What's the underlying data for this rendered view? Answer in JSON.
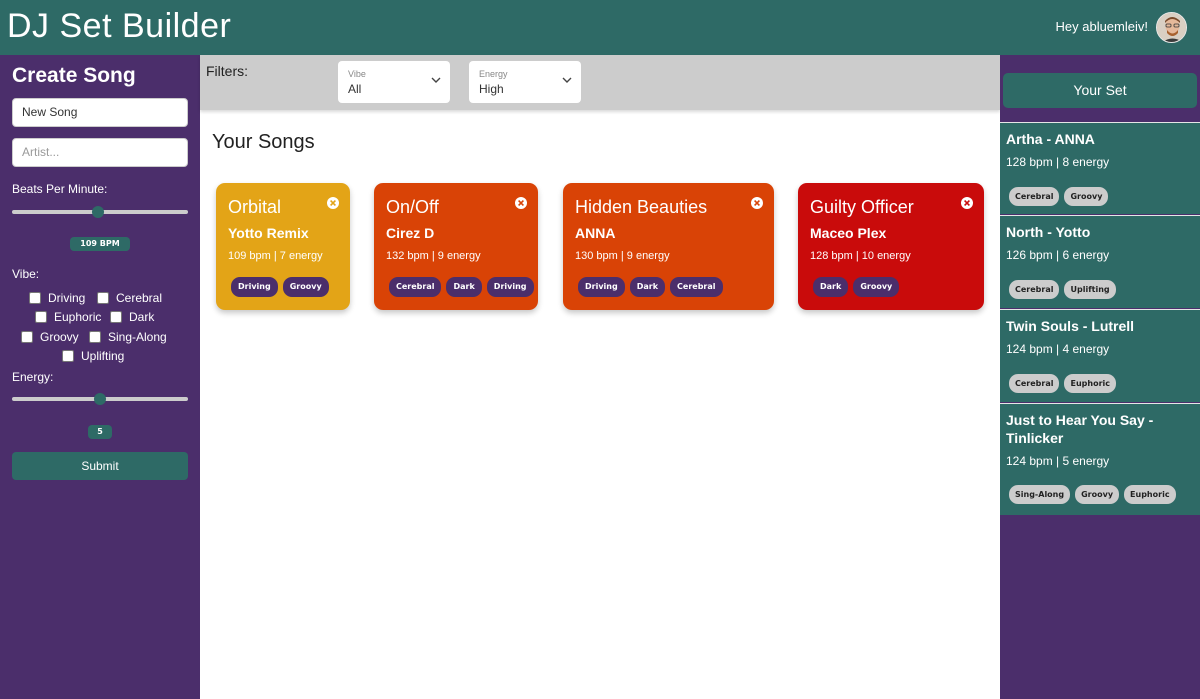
{
  "header": {
    "app_title": "DJ Set Builder",
    "greeting": "Hey abluemleiv!"
  },
  "create_song": {
    "title": "Create Song",
    "song_name_value": "New Song",
    "artist_placeholder": "Artist...",
    "bpm_label": "Beats Per Minute:",
    "bpm_value": 109,
    "bpm_display": "109 BPM",
    "vibe_label": "Vibe:",
    "vibes": [
      "Driving",
      "Cerebral",
      "Euphoric",
      "Dark",
      "Groovy",
      "Sing-Along",
      "Uplifting"
    ],
    "energy_label": "Energy:",
    "energy_value": 5,
    "energy_display": "5",
    "submit_label": "Submit"
  },
  "filters": {
    "label": "Filters:",
    "vibe_caption": "Vibe",
    "vibe_value": "All",
    "energy_caption": "Energy",
    "energy_value": "High"
  },
  "songs": {
    "title": "Your Songs",
    "items": [
      {
        "title": "Orbital",
        "artist": "Yotto Remix",
        "meta": "109 bpm | 7 energy",
        "color": "#e3a417",
        "tags": [
          "Driving",
          "Groovy"
        ]
      },
      {
        "title": "On/Off",
        "artist": "Cirez D",
        "meta": "132 bpm | 9 energy",
        "color": "#d94306",
        "tags": [
          "Cerebral",
          "Dark",
          "Driving"
        ]
      },
      {
        "title": "Hidden Beauties",
        "artist": "ANNA",
        "meta": "130 bpm | 9 energy",
        "color": "#d94306",
        "tags": [
          "Driving",
          "Dark",
          "Cerebral"
        ]
      },
      {
        "title": "Guilty Officer",
        "artist": "Maceo Plex",
        "meta": "128 bpm | 10 energy",
        "color": "#c90b0b",
        "tags": [
          "Dark",
          "Groovy"
        ]
      }
    ]
  },
  "set": {
    "title": "Your Set",
    "items": [
      {
        "title": "Artha - ANNA",
        "meta": "128 bpm | 8 energy",
        "tags": [
          "Cerebral",
          "Groovy"
        ]
      },
      {
        "title": "North - Yotto",
        "meta": "126 bpm | 6 energy",
        "tags": [
          "Cerebral",
          "Uplifting"
        ]
      },
      {
        "title": "Twin Souls - Lutrell",
        "meta": "124 bpm | 4 energy",
        "tags": [
          "Cerebral",
          "Euphoric"
        ]
      },
      {
        "title": "Just to Hear You Say - Tinlicker",
        "meta": "124 bpm | 5 energy",
        "tags": [
          "Sing-Along",
          "Groovy",
          "Euphoric"
        ]
      }
    ]
  },
  "colors": {
    "header_bg": "#2e6a66",
    "sidebar_bg": "#4b2e6b",
    "filter_bar_bg": "#cccccc"
  }
}
